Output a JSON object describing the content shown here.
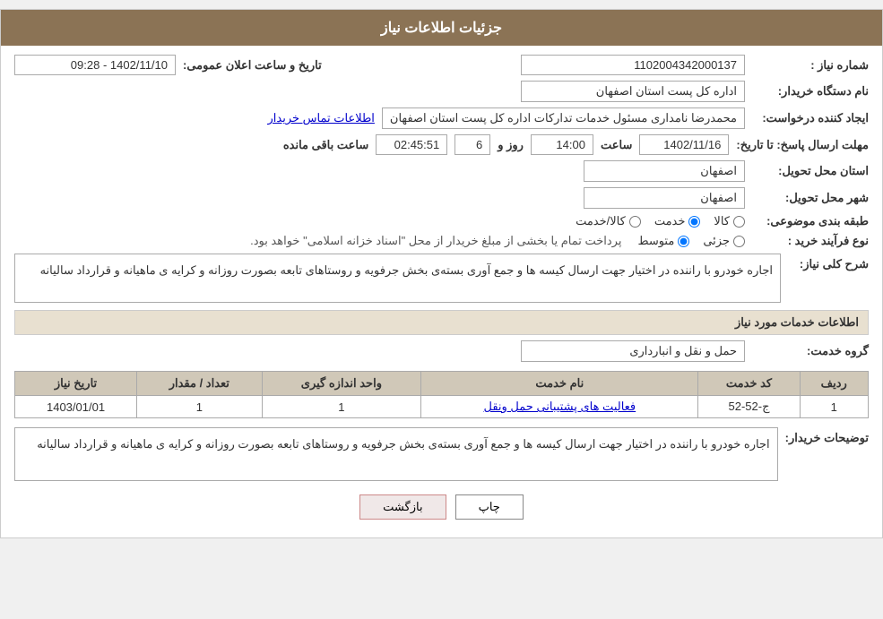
{
  "header": {
    "title": "جزئیات اطلاعات نیاز"
  },
  "fields": {
    "shomara_niaz_label": "شماره نیاز :",
    "shomara_niaz_value": "1102004342000137",
    "name_dastgah_label": "نام دستگاه خریدار:",
    "name_dastgah_value": "اداره کل پست استان اصفهان",
    "ijad_label": "ایجاد کننده درخواست:",
    "ijad_value": "محمدرضا نامداری مسئول خدمات تدارکات اداره کل پست استان اصفهان",
    "ijad_link": "اطلاعات تماس خریدار",
    "mohlet_label": "مهلت ارسال پاسخ: تا تاریخ:",
    "mohlet_date": "1402/11/16",
    "mohlet_time_label": "ساعت",
    "mohlet_time": "14:00",
    "mohlet_rooz_label": "روز و",
    "mohlet_rooz_value": "6",
    "mohlet_remaining_label": "ساعت باقی مانده",
    "mohlet_remaining": "02:45:51",
    "ostan_label": "استان محل تحویل:",
    "ostan_value": "اصفهان",
    "shahr_label": "شهر محل تحویل:",
    "shahr_value": "اصفهان",
    "tabaqe_label": "طبقه بندی موضوعی:",
    "tabaqe_kala": "کالا",
    "tabaqe_khedmat": "خدمت",
    "tabaqe_kala_khedmat": "کالا/خدمت",
    "tabaqe_selected": "khedmat",
    "nofarayand_label": "نوع فرآیند خرید :",
    "nofarayand_jazzi": "جزئی",
    "nofarayand_motawaset": "متوسط",
    "nofarayand_text": "پرداخت تمام یا بخشی از مبلغ خریدار از محل \"اسناد خزانه اسلامی\" خواهد بود.",
    "nofarayand_selected": "motawaset",
    "tarikh_aalan_label": "تاریخ و ساعت اعلان عمومی:",
    "tarikh_aalan_value": "1402/11/10 - 09:28"
  },
  "sharh_niaz": {
    "label": "شرح کلی نیاز:",
    "text": "اجاره خودرو با راننده در اختیار جهت ارسال کیسه ها و جمع آوری بسته‌ی بخش جرفویه و روستاهای تابعه بصورت روزانه و کرایه ی ماهیانه و قرارداد سالیانه"
  },
  "khadamat_section": {
    "title": "اطلاعات خدمات مورد نیاز",
    "group_label": "گروه خدمت:",
    "group_value": "حمل و نقل و انبارداری"
  },
  "table": {
    "headers": [
      "ردیف",
      "کد خدمت",
      "نام خدمت",
      "واحد اندازه گیری",
      "تعداد / مقدار",
      "تاریخ نیاز"
    ],
    "rows": [
      {
        "radif": "1",
        "kod": "ج-52-52",
        "name": "فعالیت های پشتیبانی حمل ونقل",
        "unit": "1",
        "tedaad": "1",
        "tarikh": "1403/01/01"
      }
    ]
  },
  "tawzih": {
    "label": "توضیحات خریدار:",
    "text": "اجاره خودرو با راننده در اختیار جهت ارسال کیسه ها و جمع آوری بسته‌ی بخش جرفویه و روستاهای تابعه بصورت روزانه و کرایه ی ماهیانه و قرارداد سالیانه"
  },
  "buttons": {
    "print": "چاپ",
    "back": "بازگشت"
  }
}
